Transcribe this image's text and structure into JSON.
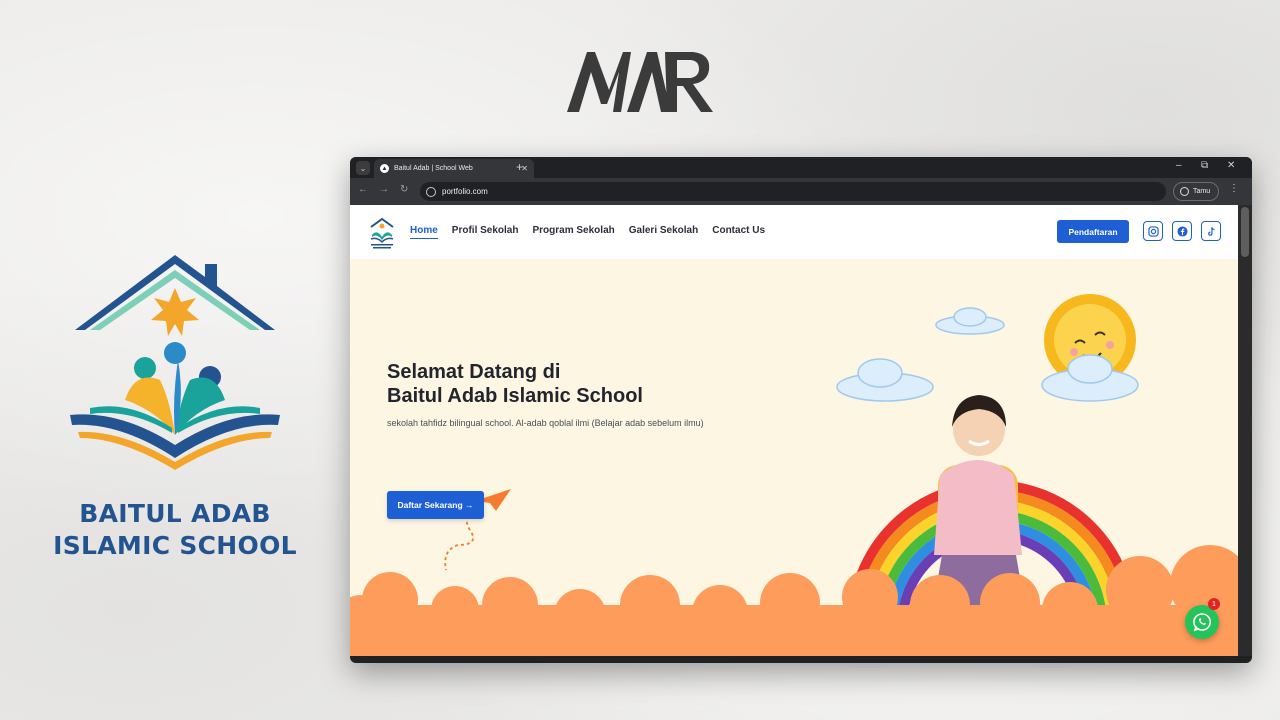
{
  "brand_logo_text": "MAR",
  "school": {
    "name_line1": "BAITUL ADAB",
    "name_line2": "ISLAMIC SCHOOL"
  },
  "browser": {
    "tab_title": "Baitul Adab | School Web",
    "url": "portfolio.com",
    "profile_label": "Tamu"
  },
  "site": {
    "nav": {
      "links": [
        "Home",
        "Profil Sekolah",
        "Program Sekolah",
        "Galeri Sekolah",
        "Contact Us"
      ],
      "active": "Home",
      "cta_label": "Pendaftaran"
    },
    "hero": {
      "title_line1": "Selamat Datang di",
      "title_line2": "Baitul Adab Islamic School",
      "subtitle": "sekolah tahfidz bilingual school. Al-adab qoblal ilmi (Belajar adab sebelum ilmu)",
      "button_label": "Daftar Sekarang →"
    },
    "whatsapp_badge": "1"
  },
  "colors": {
    "accent": "#1f5fd6",
    "hero_bg": "#fdf6e2",
    "cloud_orange": "#fd9c5b",
    "school_blue": "#24548f",
    "whatsapp": "#25c45a"
  },
  "icons": [
    "instagram-icon",
    "facebook-icon",
    "tiktok-icon",
    "whatsapp-icon",
    "arrow-right-icon"
  ]
}
